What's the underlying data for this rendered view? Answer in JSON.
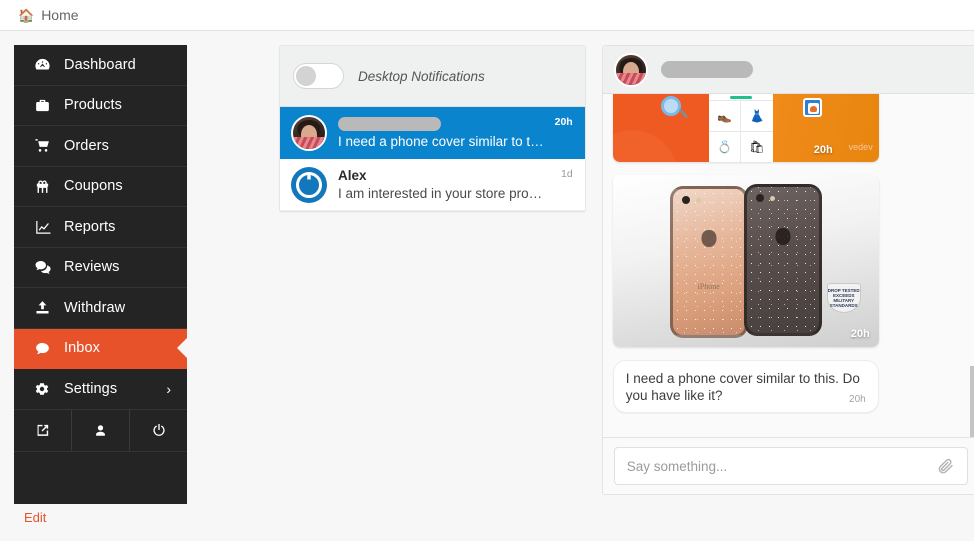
{
  "topbar": {
    "home_icon": "home-icon",
    "home_label": "Home"
  },
  "sidebar": {
    "items": [
      {
        "label": "Dashboard",
        "icon": "dashboard-icon",
        "active": false
      },
      {
        "label": "Products",
        "icon": "briefcase-icon",
        "active": false
      },
      {
        "label": "Orders",
        "icon": "cart-icon",
        "active": false
      },
      {
        "label": "Coupons",
        "icon": "gift-icon",
        "active": false
      },
      {
        "label": "Reports",
        "icon": "chart-line-icon",
        "active": false
      },
      {
        "label": "Reviews",
        "icon": "comments-icon",
        "active": false
      },
      {
        "label": "Withdraw",
        "icon": "upload-icon",
        "active": false
      },
      {
        "label": "Inbox",
        "icon": "chat-bubble-icon",
        "active": true
      },
      {
        "label": "Settings",
        "icon": "gear-icon",
        "active": false,
        "chevron": "›"
      }
    ],
    "icon_row": [
      {
        "name": "external-link-icon"
      },
      {
        "name": "user-icon"
      },
      {
        "name": "power-icon"
      }
    ],
    "edit_label": "Edit",
    "accent_color": "#e8522a",
    "bg_color": "#242424"
  },
  "conversations": {
    "notifications": {
      "label": "Desktop Notifications",
      "toggle_state": "off"
    },
    "rows": [
      {
        "name": "",
        "name_redacted": true,
        "snippet": "I need a phone cover similar to t…",
        "time": "20h",
        "selected": true,
        "avatar": "photo"
      },
      {
        "name": "Alex",
        "name_redacted": false,
        "snippet": "I am interested in your store pro…",
        "time": "1d",
        "selected": false,
        "avatar": "brand"
      }
    ],
    "selected_color": "#0b84ce"
  },
  "chat": {
    "header": {
      "name": "",
      "name_redacted": true,
      "avatar": "photo"
    },
    "messages": [
      {
        "type": "image",
        "kind": "promo-banner",
        "time": "20h",
        "watermark": "vedev"
      },
      {
        "type": "image",
        "kind": "phone-cases-photo",
        "time": "20h",
        "badge_lines": [
          "DROP TESTED",
          "EXCEEDS",
          "MILITARY",
          "STANDARDS"
        ]
      },
      {
        "type": "text",
        "text": "I need a phone cover similar to this. Do you have like it?",
        "time": "20h"
      }
    ],
    "input": {
      "placeholder": "Say something...",
      "value": "",
      "attach_icon": "paperclip-icon"
    },
    "scrollbar": {
      "visible": true
    }
  }
}
